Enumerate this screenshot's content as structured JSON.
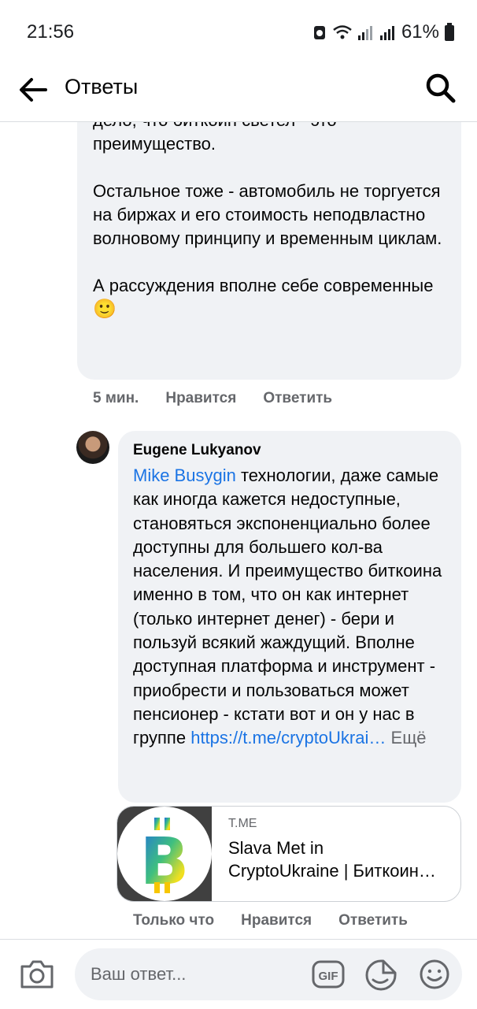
{
  "status_bar": {
    "time": "21:56",
    "battery_percent": "61%"
  },
  "header": {
    "title": "Ответы",
    "back_icon": "arrow-left-icon",
    "search_icon": "search-icon"
  },
  "comment_1": {
    "text_partial_top": "дело, что биткоин светел - это",
    "text": "преимущество.\n\nОстальное тоже - автомобиль не торгуется на биржах и его стоимость неподвластно волновому принципу и временным циклам.\n\nА рассуждения вполне себе современные",
    "emoji": "🙂",
    "time": "5 мин.",
    "like_label": "Нравится",
    "reply_label": "Ответить"
  },
  "comment_2": {
    "author": "Eugene Lukyanov",
    "mention": "Mike Busygin",
    "text": " технологии, даже самые как иногда кажется недоступные, становяться экспоненциально более доступны для большего кол-ва населения. И преимущество биткоина именно в том, что он как интернет (только интернет денег) - бери и пользуй всякий жаждущий. Вполне доступная платформа и инструмент - приобрести и пользоваться может пенсионер - кстати вот и он у нас в группе",
    "link_text": "https://t.me/cryptoUkrai…",
    "more_label": "Ещё",
    "time": "Только что",
    "like_label": "Нравится",
    "reply_label": "Ответить"
  },
  "link_preview": {
    "domain": "T.ME",
    "title_line1": "Slava Met in",
    "title_line2": "CryptoUkraine | Биткоин…",
    "logo_letter": "B"
  },
  "composer": {
    "placeholder": "Ваш ответ...",
    "gif_label": "GIF",
    "icons": [
      "camera-icon",
      "gif-icon",
      "sticker-icon",
      "emoji-icon"
    ]
  }
}
